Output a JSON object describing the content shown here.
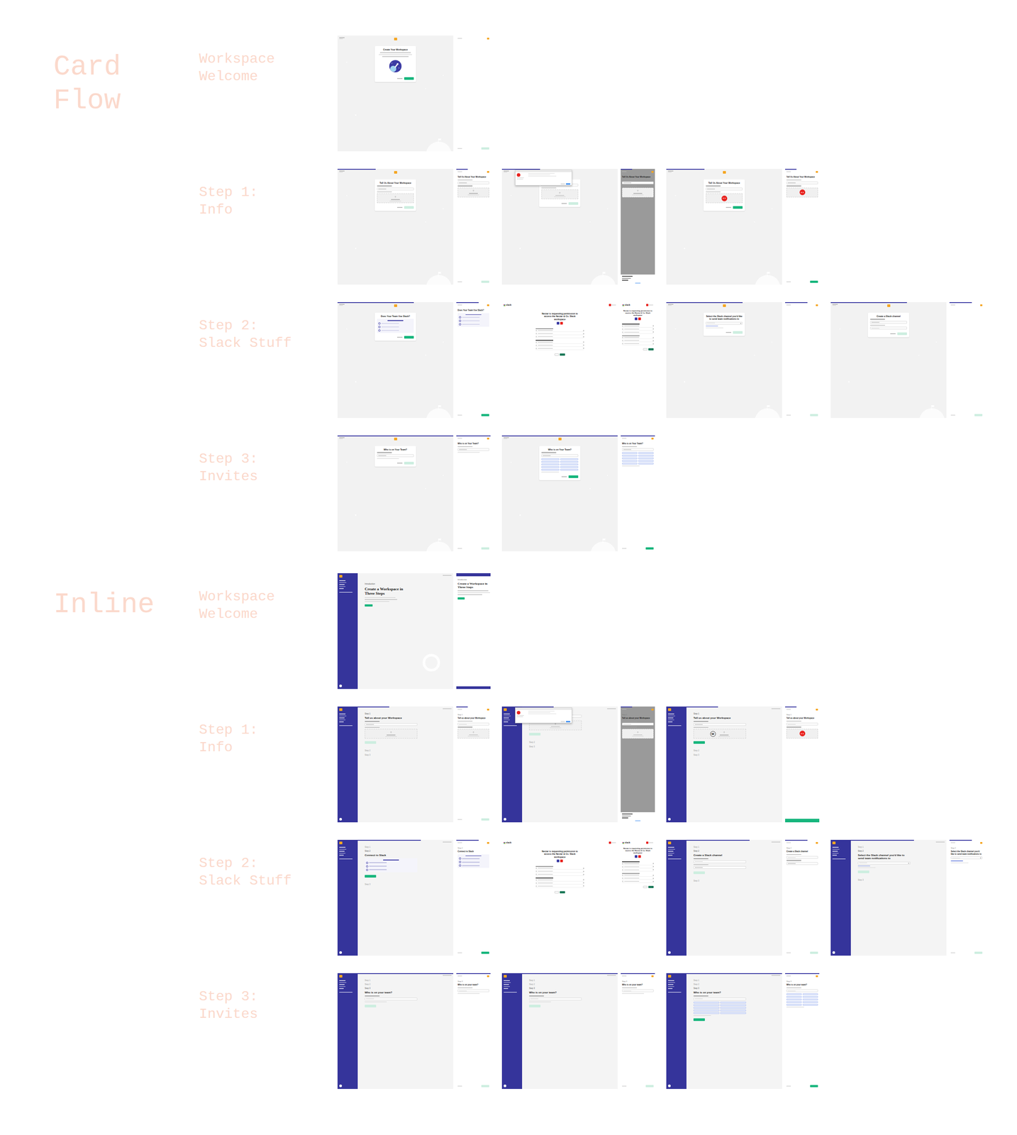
{
  "sections": [
    {
      "label": "Card Flow",
      "rows": [
        {
          "label": "Workspace Welcome",
          "screens": [
            {
              "kind": "card",
              "title": "Create Your Workspace",
              "content": "welcome",
              "progress": 0,
              "overlay": "none",
              "logo": "none",
              "button_enabled": true
            },
            {
              "kind": "mobile",
              "content": "none",
              "progress": 0,
              "overlay": "none",
              "logo": "none",
              "button_enabled": false
            }
          ]
        },
        {
          "label": "Step 1: Info",
          "screens": [
            {
              "kind": "card",
              "title": "Tell Us About Your Workspace",
              "content": "upload",
              "progress": 0.33,
              "overlay": "none",
              "logo": "none",
              "button_enabled": false
            },
            {
              "kind": "mobile",
              "title": "Tell Us About Your Workspace",
              "content": "upload",
              "progress": 0.33,
              "overlay": "none",
              "logo": "none",
              "button_enabled": false
            },
            {
              "kind": "card",
              "content": "upload",
              "progress": 0.33,
              "overlay": "file-dialog",
              "logo": "none",
              "button_enabled": false
            },
            {
              "kind": "mobile",
              "title": "Tell Us About Your Workspace",
              "content": "upload",
              "progress": 0.33,
              "overlay": "action-sheet",
              "logo": "none",
              "button_enabled": false
            },
            {
              "kind": "card",
              "title": "Tell Us About Your Workspace",
              "content": "upload",
              "progress": 0.33,
              "overlay": "none",
              "logo": "red",
              "button_enabled": true
            },
            {
              "kind": "mobile",
              "title": "Tell Us About Your Workspace",
              "content": "upload",
              "progress": 0.33,
              "overlay": "none",
              "logo": "red",
              "button_enabled": true
            }
          ]
        },
        {
          "label": "Step 2: Slack Stuff",
          "screens": [
            {
              "kind": "card",
              "title": "Does Your Team Use Slack?",
              "content": "benefits",
              "progress": 0.66,
              "overlay": "none",
              "logo": "none",
              "button_enabled": true
            },
            {
              "kind": "mobile",
              "title": "Does Your Team Use Slack?",
              "content": "benefits",
              "progress": 0.66,
              "overlay": "none",
              "logo": "none",
              "button_enabled": true
            },
            {
              "kind": "slack",
              "brand": "slack",
              "title": "Nectar is requesting permission to access the Nectar & Co. Slack workspace",
              "content": "none",
              "progress": 0,
              "overlay": "none",
              "logo": "none",
              "button_enabled": true
            },
            {
              "kind": "slack-mobile",
              "brand": "slack",
              "title": "Nectar is requesting permission to access the Nectar & Co. Slack workspace",
              "content": "none",
              "progress": 0,
              "overlay": "none",
              "logo": "none",
              "button_enabled": true
            },
            {
              "kind": "card",
              "title": "Select the Slack channel you'd like to send team notifications to",
              "content": "channel-select",
              "progress": 0.66,
              "overlay": "none",
              "logo": "none",
              "button_enabled": false
            },
            {
              "kind": "mobile",
              "content": "none",
              "progress": 0.66,
              "overlay": "none",
              "logo": "none",
              "button_enabled": false
            },
            {
              "kind": "card",
              "title": "Create a Slack channel",
              "content": "channel-form",
              "progress": 0.66,
              "overlay": "none",
              "logo": "none",
              "button_enabled": false
            },
            {
              "kind": "mobile",
              "content": "none",
              "progress": 0.66,
              "overlay": "none",
              "logo": "none",
              "button_enabled": false
            }
          ]
        },
        {
          "label": "Step 3: Invites",
          "screens": [
            {
              "kind": "card",
              "title": "Who is on Your Team?",
              "content": "invite",
              "progress": 1,
              "overlay": "none",
              "logo": "none",
              "button_enabled": false
            },
            {
              "kind": "mobile",
              "title": "Who is on Your Team?",
              "content": "invite",
              "progress": 1,
              "overlay": "none",
              "logo": "none",
              "button_enabled": false
            },
            {
              "kind": "card",
              "title": "Who is on Your Team?",
              "content": "chips",
              "progress": 1,
              "overlay": "none",
              "logo": "none",
              "button_enabled": true
            },
            {
              "kind": "mobile",
              "title": "Who is on Your Team?",
              "content": "chips",
              "progress": 1,
              "overlay": "none",
              "logo": "none",
              "button_enabled": true
            }
          ]
        }
      ]
    },
    {
      "label": "Inline",
      "rows": [
        {
          "label": "Workspace Welcome",
          "screens": [
            {
              "kind": "inline",
              "intro": "Introduction",
              "title": "Create a Workspace in Three Steps",
              "content": "intro",
              "progress": 0,
              "overlay": "none",
              "logo": "none",
              "button_enabled": true
            },
            {
              "kind": "mobile",
              "intro": "Introduction",
              "title": "Create a Workspace in Three Steps",
              "content": "intro",
              "progress": 0,
              "overlay": "none",
              "logo": "none",
              "button_enabled": true
            }
          ]
        },
        {
          "label": "Step 1: Info",
          "screens": [
            {
              "kind": "inline",
              "step": "Step 1",
              "title": "Tell us about your Workspace",
              "content": "upload",
              "steps_after": [
                "Step 2",
                "Step 3"
              ],
              "progress": 0.33,
              "overlay": "none",
              "logo": "none",
              "button_enabled": false
            },
            {
              "kind": "mobile",
              "step": "Step 1",
              "title": "Tell us about your Workspace",
              "content": "upload",
              "progress": 0.33,
              "overlay": "none",
              "logo": "none",
              "button_enabled": false
            },
            {
              "kind": "inline",
              "content": "upload",
              "steps_after": [
                "Step 2",
                "Step 3"
              ],
              "progress": 0.33,
              "overlay": "file-dialog",
              "logo": "none",
              "button_enabled": false
            },
            {
              "kind": "mobile",
              "step": "Step 1",
              "title": "Tell us about your Workspace",
              "content": "upload",
              "progress": 0.33,
              "overlay": "action-sheet",
              "logo": "none",
              "button_enabled": false
            },
            {
              "kind": "inline",
              "step": "Step 1",
              "title": "Tell us about your Workspace",
              "content": "upload",
              "steps_after": [
                "Step 2",
                "Step 3"
              ],
              "progress": 0.33,
              "overlay": "none",
              "logo": "w",
              "logo_text": "W",
              "button_enabled": true
            },
            {
              "kind": "mobile",
              "step": "Step 1",
              "title": "Tell us about your Workspace",
              "content": "upload",
              "progress": 0.33,
              "overlay": "none",
              "logo": "red",
              "button_enabled": true
            }
          ]
        },
        {
          "label": "Step 2: Slack Stuff",
          "screens": [
            {
              "kind": "inline",
              "steps_before": [
                "Step 1"
              ],
              "step": "Step 2",
              "title": "Connect to Slack",
              "content": "benefits",
              "steps_after": [
                "Step 3"
              ],
              "progress": 0.66,
              "overlay": "none",
              "logo": "none",
              "button_enabled": true
            },
            {
              "kind": "mobile",
              "step": "Step 2",
              "title": "Connect to Slack",
              "content": "benefits",
              "progress": 0.66,
              "overlay": "none",
              "logo": "none",
              "button_enabled": true
            },
            {
              "kind": "slack",
              "brand": "slack",
              "title": "Nectar is requesting permission to access the Nectar & Co. Slack workspace",
              "content": "none",
              "progress": 0,
              "overlay": "none",
              "logo": "none",
              "button_enabled": true
            },
            {
              "kind": "slack-mobile",
              "brand": "slack",
              "title": "Nectar is requesting permission to access the Nectar & Co. Slack workspace",
              "content": "none",
              "progress": 0,
              "overlay": "none",
              "logo": "none",
              "button_enabled": true
            },
            {
              "kind": "inline",
              "steps_before": [
                "Step 1"
              ],
              "step": "Step 2",
              "title": "Create a Slack channel",
              "content": "channel-form",
              "steps_after": [
                "Step 3"
              ],
              "progress": 0.66,
              "overlay": "none",
              "logo": "none",
              "button_enabled": false
            },
            {
              "kind": "mobile",
              "step": "Step 2",
              "title": "Create a Slack channel",
              "content": "channel-form",
              "progress": 0.66,
              "overlay": "none",
              "logo": "none",
              "button_enabled": false
            },
            {
              "kind": "inline",
              "steps_before": [
                "Step 1"
              ],
              "step": "Step 2",
              "title": "Select the Slack channel you'd like to send team notifications to",
              "content": "channel-select",
              "steps_after": [
                "Step 3"
              ],
              "progress": 0.66,
              "overlay": "none",
              "logo": "none",
              "button_enabled": false
            },
            {
              "kind": "mobile",
              "step": "Step 2",
              "title": "Select the Slack channel you'd like to send team notifications to",
              "content": "channel-select",
              "progress": 0.66,
              "overlay": "none",
              "logo": "none",
              "button_enabled": false
            }
          ]
        },
        {
          "label": "Step 3: Invites",
          "screens": [
            {
              "kind": "inline",
              "steps_before": [
                "Step 1",
                "Step 2"
              ],
              "step": "Step 3",
              "title": "Who is on your team?",
              "content": "invite",
              "progress": 1,
              "overlay": "none",
              "logo": "none",
              "button_enabled": false
            },
            {
              "kind": "mobile",
              "step": "Step 3",
              "title": "Who is on your team?",
              "content": "invite",
              "progress": 1,
              "overlay": "none",
              "logo": "none",
              "button_enabled": false
            },
            {
              "kind": "inline",
              "steps_before": [
                "Step 1",
                "Step 2"
              ],
              "step": "Step 3",
              "title": "Who is on your team?",
              "content": "invite",
              "progress": 1,
              "overlay": "none",
              "logo": "none",
              "button_enabled": false
            },
            {
              "kind": "mobile",
              "step": "Step 3",
              "title": "Who is on your team?",
              "content": "invite",
              "progress": 1,
              "overlay": "none",
              "logo": "none",
              "button_enabled": false
            },
            {
              "kind": "inline",
              "steps_before": [
                "Step 1",
                "Step 2"
              ],
              "step": "Step 3",
              "title": "Who is on your team?",
              "content": "chips",
              "progress": 1,
              "overlay": "none",
              "logo": "none",
              "button_enabled": true
            },
            {
              "kind": "mobile",
              "step": "Step 3",
              "title": "Who is on your team?",
              "content": "chips",
              "progress": 1,
              "overlay": "none",
              "logo": "none",
              "button_enabled": true
            }
          ]
        }
      ]
    }
  ]
}
